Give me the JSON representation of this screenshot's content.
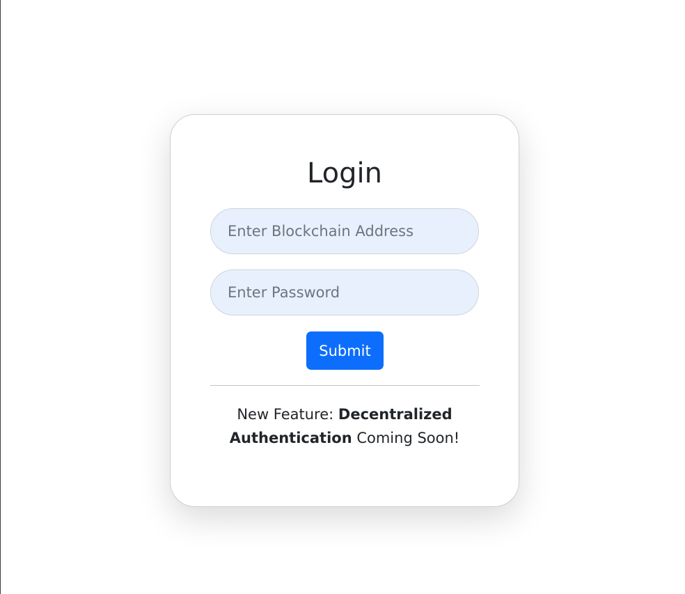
{
  "login": {
    "title": "Login",
    "address_placeholder": "Enter Blockchain Address",
    "address_value": "",
    "password_placeholder": "Enter Password",
    "password_value": "",
    "submit_label": "Submit",
    "feature": {
      "prefix": "New Feature: ",
      "highlight": "Decentralized Authentication",
      "suffix": " Coming Soon!"
    }
  },
  "colors": {
    "primary_button": "#0d6efd",
    "input_background": "#e8f0fe",
    "card_border": "#cfcfcf",
    "text": "#212529"
  }
}
